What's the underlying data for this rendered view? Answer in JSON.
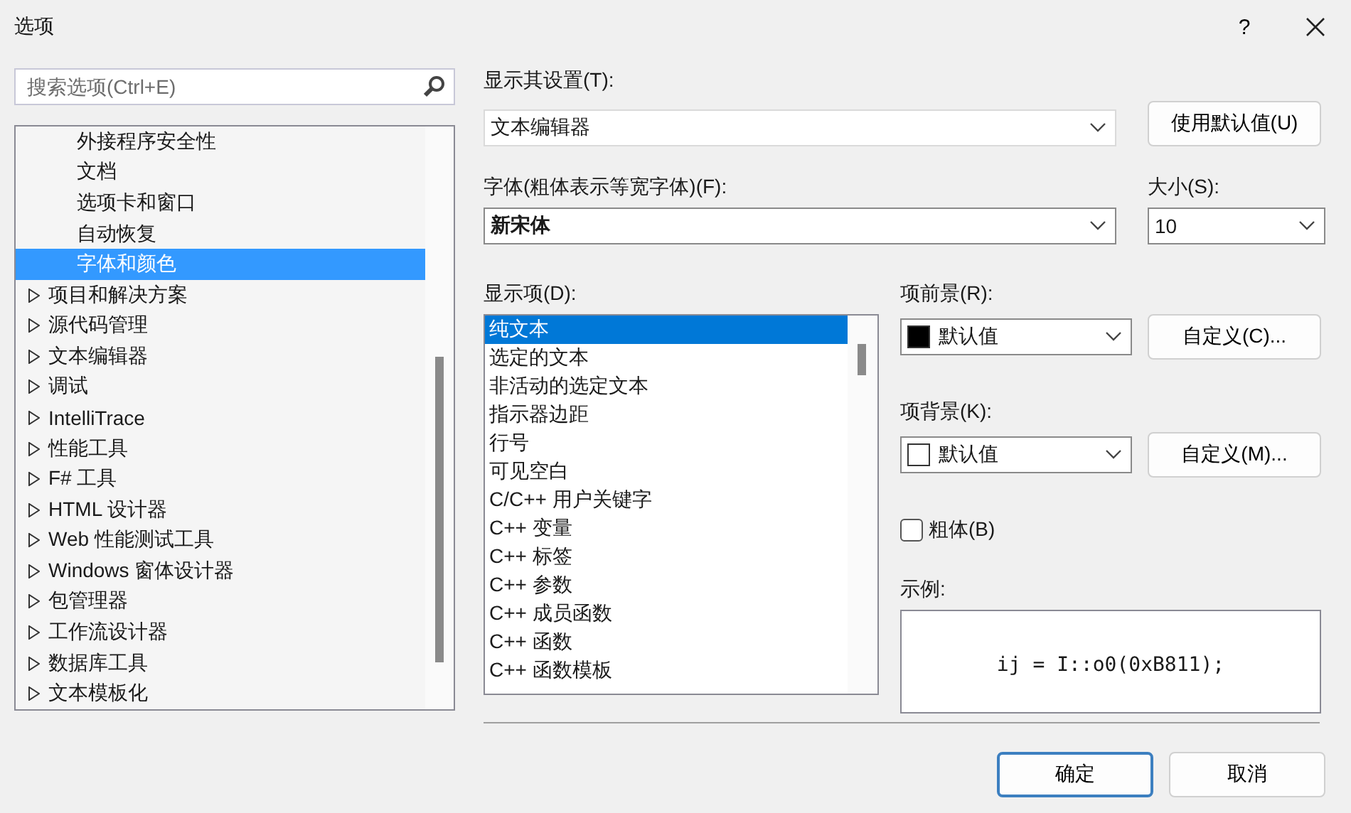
{
  "window": {
    "title": "选项",
    "help": "?"
  },
  "search": {
    "placeholder": "搜索选项(Ctrl+E)"
  },
  "tree": {
    "sub_items": [
      {
        "label": "外接程序安全性",
        "selected": false
      },
      {
        "label": "文档",
        "selected": false
      },
      {
        "label": "选项卡和窗口",
        "selected": false
      },
      {
        "label": "自动恢复",
        "selected": false
      },
      {
        "label": "字体和颜色",
        "selected": true
      }
    ],
    "items": [
      {
        "label": "项目和解决方案",
        "expanded": false
      },
      {
        "label": "源代码管理",
        "expanded": false
      },
      {
        "label": "文本编辑器",
        "expanded": false
      },
      {
        "label": "调试",
        "expanded": false
      },
      {
        "label": "IntelliTrace",
        "expanded": false
      },
      {
        "label": "性能工具",
        "expanded": false
      },
      {
        "label": "F# 工具",
        "expanded": false
      },
      {
        "label": "HTML 设计器",
        "expanded": false
      },
      {
        "label": "Web 性能测试工具",
        "expanded": false
      },
      {
        "label": "Windows 窗体设计器",
        "expanded": false
      },
      {
        "label": "包管理器",
        "expanded": false
      },
      {
        "label": "工作流设计器",
        "expanded": false
      },
      {
        "label": "数据库工具",
        "expanded": false
      },
      {
        "label": "文本模板化",
        "expanded": false
      }
    ]
  },
  "show_settings_for": {
    "label": "显示其设置(T):",
    "value": "文本编辑器"
  },
  "use_defaults_button": "使用默认值(U)",
  "font": {
    "label": "字体(粗体表示等宽字体)(F):",
    "value": "新宋体"
  },
  "size": {
    "label": "大小(S):",
    "value": "10"
  },
  "display_items": {
    "label": "显示项(D):",
    "items": [
      {
        "label": "纯文本",
        "selected": true
      },
      {
        "label": "选定的文本",
        "selected": false
      },
      {
        "label": "非活动的选定文本",
        "selected": false
      },
      {
        "label": "指示器边距",
        "selected": false
      },
      {
        "label": "行号",
        "selected": false
      },
      {
        "label": "可见空白",
        "selected": false
      },
      {
        "label": "C/C++ 用户关键字",
        "selected": false
      },
      {
        "label": "C++ 变量",
        "selected": false
      },
      {
        "label": "C++ 标签",
        "selected": false
      },
      {
        "label": "C++ 参数",
        "selected": false
      },
      {
        "label": "C++ 成员函数",
        "selected": false
      },
      {
        "label": "C++ 函数",
        "selected": false
      },
      {
        "label": "C++ 函数模板",
        "selected": false
      }
    ]
  },
  "foreground": {
    "label": "项前景(R):",
    "value": "默认值",
    "color": "#000000",
    "button": "自定义(C)..."
  },
  "background": {
    "label": "项背景(K):",
    "value": "默认值",
    "color": "#ffffff",
    "button": "自定义(M)..."
  },
  "bold": {
    "label": "粗体(B)",
    "checked": false
  },
  "sample": {
    "label": "示例:",
    "text": "ij = I::o0(0xB811);"
  },
  "buttons": [
    {
      "label": "确定",
      "default": true
    },
    {
      "label": "取消",
      "default": false
    }
  ]
}
